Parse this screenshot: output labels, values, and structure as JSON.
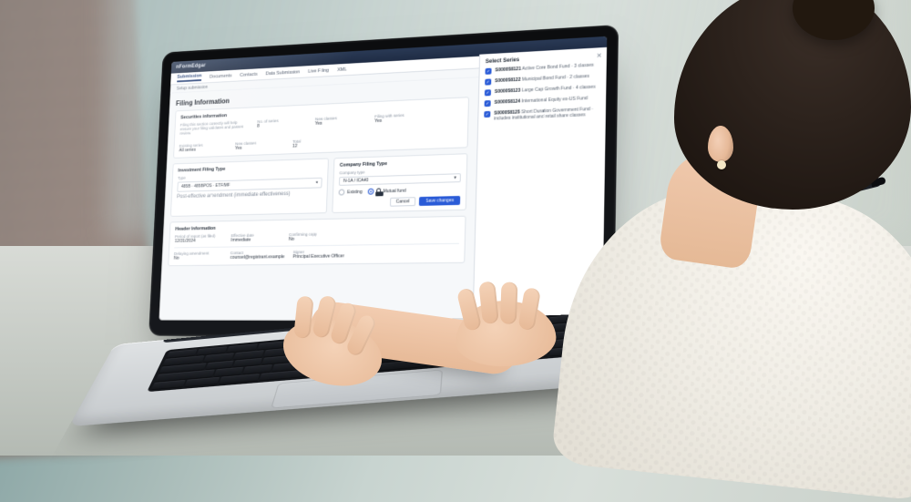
{
  "brand": "nFormEdgar",
  "breadcrumb": "Setup submission",
  "nav": {
    "items": [
      "Submission",
      "Documents",
      "Contacts",
      "Data Submission",
      "Live Filing",
      "XML"
    ],
    "active": 0
  },
  "page_title": "Filing Information",
  "panel_securities": {
    "heading": "Securities information",
    "description": "Filing this section correctly will help ensure your filing validates and passes review.",
    "fields": [
      {
        "label": "No. of series",
        "value": "8"
      },
      {
        "label": "New classes",
        "value": "Yes"
      },
      {
        "label": "Filing with series",
        "value": "Yes"
      },
      {
        "label": "Existing series",
        "value": "All series"
      },
      {
        "label": "New classes",
        "value": "Yes"
      },
      {
        "label": "Total",
        "value": "12"
      }
    ]
  },
  "panel_inv_type": {
    "heading": "Investment Filing Type",
    "field_label": "Type",
    "field_value": "485B · 485BPOS · ETF/MF",
    "description": "Post-effective amendment (immediate effectiveness)"
  },
  "panel_comp_type": {
    "heading": "Company Filing Type",
    "field_label": "Company type",
    "field_value": "N-1A / ICA40",
    "options": [
      {
        "label": "Existing",
        "selected": false
      },
      {
        "label": "Mutual fund",
        "selected": true
      }
    ],
    "buttons": {
      "cancel": "Cancel",
      "primary": "Save changes"
    }
  },
  "panel_header": {
    "heading": "Header Information",
    "fields": [
      {
        "label": "Period of report (as filed)",
        "value": "12/31/2024"
      },
      {
        "label": "Effective date",
        "value": "Immediate"
      },
      {
        "label": "Confirming copy",
        "value": "No"
      },
      {
        "label": "Delaying amendment",
        "value": "No"
      },
      {
        "label": "Contact",
        "value": "counsel@registrant.example"
      },
      {
        "label": "Signer",
        "value": "Principal Executive Officer"
      }
    ]
  },
  "rail": {
    "title": "Select Series",
    "items": [
      {
        "id": "S000058121",
        "desc": "Active Core Bond Fund · 3 classes"
      },
      {
        "id": "S000058122",
        "desc": "Municipal Bond Fund · 2 classes"
      },
      {
        "id": "S000058123",
        "desc": "Large Cap Growth Fund · 4 classes"
      },
      {
        "id": "S000058124",
        "desc": "International Equity ex-US Fund"
      },
      {
        "id": "S000058125",
        "desc": "Short Duration Government Fund · includes institutional and retail share classes"
      }
    ]
  }
}
